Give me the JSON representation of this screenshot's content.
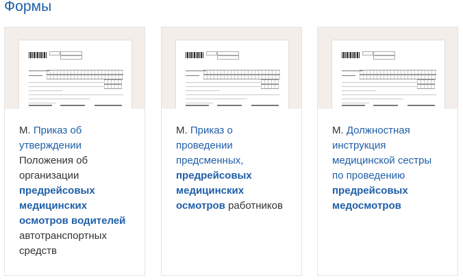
{
  "section": {
    "title": "Формы"
  },
  "cards": [
    {
      "prefix": "М.",
      "link_text": "Приказ об утверждении",
      "plain_before": "Положения об организации",
      "bold_text": "предрейсовых медицинских осмотров водителей",
      "plain_after": "автотранспортных средств"
    },
    {
      "prefix": "М.",
      "link_text": "Приказ о проведении предсменных,",
      "plain_before": "",
      "bold_text": "предрейсовых медицинских осмотров",
      "plain_after": "работников"
    },
    {
      "prefix": "М.",
      "link_text": "Должностная инструкция медицинской сестры по проведению",
      "plain_before": "",
      "bold_text": "предрейсовых медосмотров",
      "plain_after": ""
    }
  ],
  "colors": {
    "link": "#1f5fa8",
    "text": "#333333",
    "thumb_bg": "#f3eeea",
    "border": "#e4e4e4"
  }
}
